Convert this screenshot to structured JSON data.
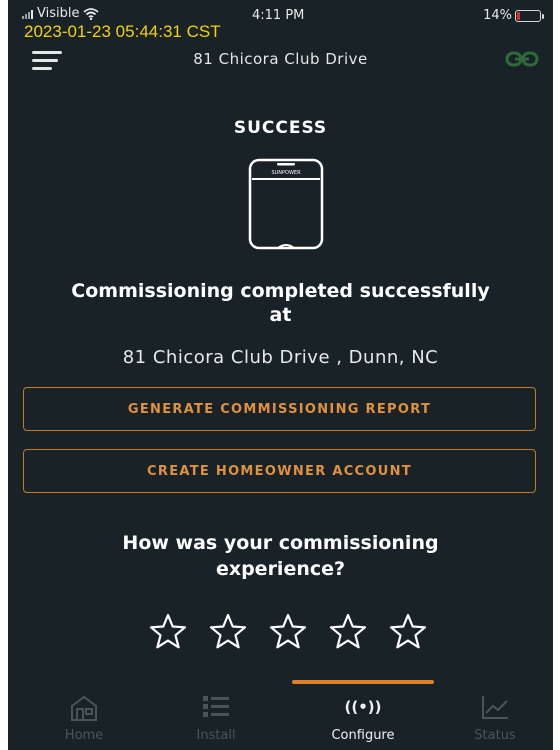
{
  "status_bar": {
    "carrier": "Visible",
    "time": "4:11 PM",
    "battery": "14%",
    "battery_level_percent": 14
  },
  "overlay": {
    "timestamp": "2023-01-23 05:44:31 CST"
  },
  "header": {
    "title": "81 Chicora Club Drive"
  },
  "main": {
    "success_title": "SUCCESS",
    "device_brand": "SUNPOWER",
    "message_line1": "Commissioning completed successfully",
    "message_line2": "at",
    "address": "81 Chicora Club Drive , Dunn, NC",
    "generate_report_label": "GENERATE COMMISSIONING REPORT",
    "create_account_label": "CREATE HOMEOWNER ACCOUNT",
    "question_line1": "How was your commissioning",
    "question_line2": "experience?",
    "rating": 0,
    "rating_max": 5
  },
  "tabs": [
    {
      "label": "Home",
      "icon": "home-icon",
      "active": false
    },
    {
      "label": "Install",
      "icon": "list-icon",
      "active": false
    },
    {
      "label": "Configure",
      "icon": "broadcast-icon",
      "active": true
    },
    {
      "label": "Status",
      "icon": "line-chart-icon",
      "active": false
    }
  ],
  "colors": {
    "background": "#182227",
    "accent": "#e0913c",
    "timestamp": "#f2d20a",
    "link_icon": "#2f6b3a"
  }
}
